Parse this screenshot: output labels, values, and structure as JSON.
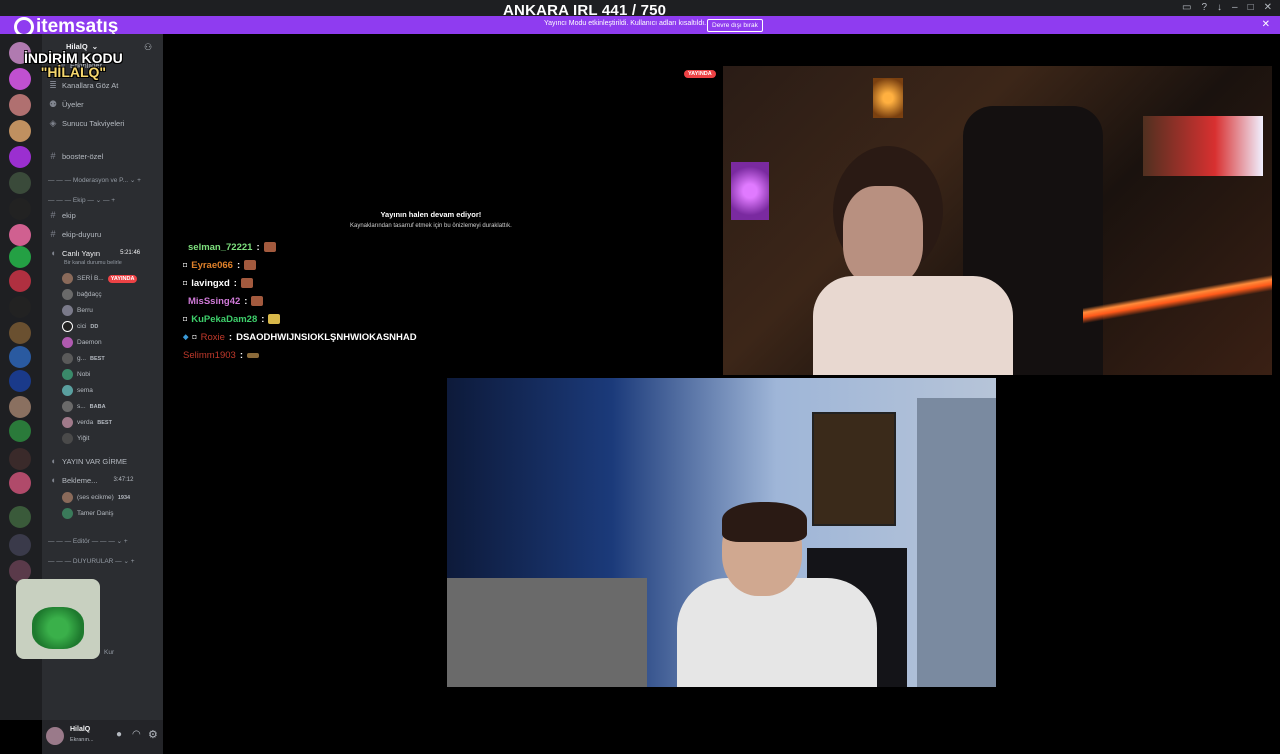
{
  "overlay": {
    "title": "ANKARA IRL 441 / 750",
    "brand": "itemsatış",
    "promo_line1": "İNDİRİM KODU",
    "promo_line2": "\"HİLALQ\""
  },
  "banner": {
    "text": "Yayıncı Modu etkinleştirildi. Kullanıcı adları kısaltıldı.",
    "button": "Devre dışı bırak"
  },
  "sidebar": {
    "server_name": "HilalQ",
    "items": [
      {
        "label": "Etkinlikler"
      },
      {
        "label": "Kanallara Göz At"
      },
      {
        "label": "Üyeler"
      },
      {
        "label": "Sunucu Takviyeleri"
      },
      {
        "label": "booster-özel"
      },
      {
        "label": "Moderasyon ve P..."
      },
      {
        "label": "Ekip"
      },
      {
        "label": "ekip"
      },
      {
        "label": "ekip-duyuru"
      },
      {
        "label": "Canlı Yayın"
      },
      {
        "label": "YAYIN VAR GİRME"
      },
      {
        "label": "Bekleme..."
      },
      {
        "label": "Editör"
      },
      {
        "label": "DUYURULAR"
      },
      {
        "label": "Kur"
      }
    ],
    "live_timer": "5:21:46",
    "live_status": "Bir kanal durumu belirle",
    "wait_timer": "3:47:12",
    "voice_users": [
      {
        "name": "SERİ B...",
        "badge": "YAYINDA"
      },
      {
        "name": "bağdaçç"
      },
      {
        "name": "Berru"
      },
      {
        "name": "cici",
        "badge": "DD"
      },
      {
        "name": "Daemon"
      },
      {
        "name": "g...",
        "badge": "BEST"
      },
      {
        "name": "Nobi"
      },
      {
        "name": "sema"
      },
      {
        "name": "s...",
        "badge": "BABA"
      },
      {
        "name": "verda",
        "badge": "BEST"
      },
      {
        "name": "Yiğit"
      }
    ],
    "wait_users": [
      {
        "name": "(ses ecikme)",
        "badge": "1934"
      },
      {
        "name": "Tamer Daniş"
      }
    ],
    "user_name": "HilalQ",
    "user_status": "Ekranın..."
  },
  "stage": {
    "paused_title": "Yayının halen devam ediyor!",
    "paused_sub": "Kaynaklarından tasarruf etmek için bu önizlemeyi duraklattık.",
    "live_tag": "YAYINDA"
  },
  "chat": [
    {
      "user": "selman_72221",
      "color": "#7ee07e",
      "text": ""
    },
    {
      "user": "Eyrae066",
      "color": "#e0812a",
      "text": ""
    },
    {
      "user": "lavingxd",
      "color": "#ffffff",
      "text": ""
    },
    {
      "user": "MisSsing42",
      "color": "#d07ad8",
      "text": ""
    },
    {
      "user": "KuPekaDam28",
      "color": "#3ecf6b",
      "text": ""
    },
    {
      "user": "Roxie",
      "color": "#c0392b",
      "text": "DSAODHWIJNSIOKLŞNHWIOKASNHAD"
    },
    {
      "user": "Selimm1903",
      "color": "#c0392b",
      "text": ""
    }
  ]
}
